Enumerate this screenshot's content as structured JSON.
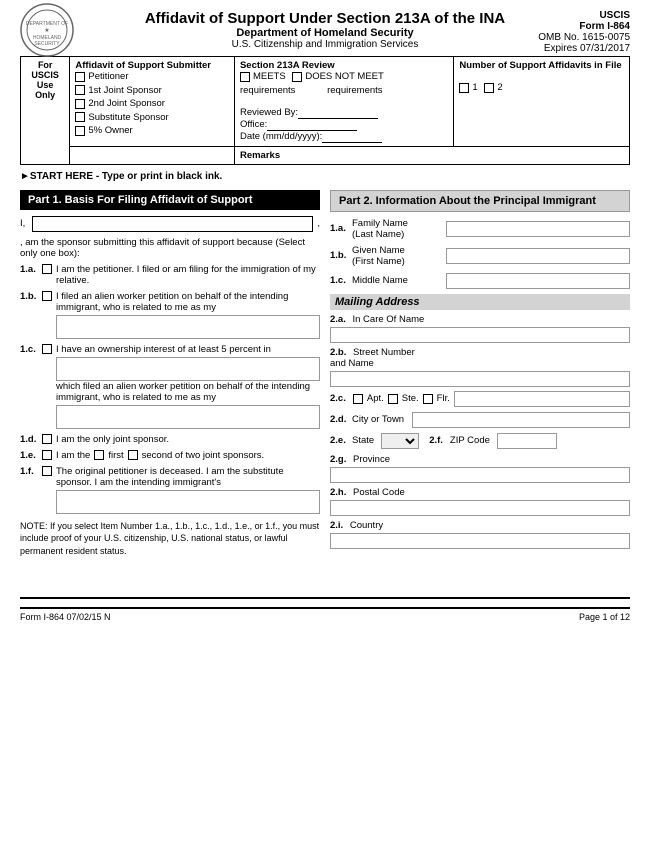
{
  "header": {
    "title": "Affidavit of Support Under Section 213A of the INA",
    "dept": "Department of Homeland Security",
    "agency": "U.S. Citizenship and Immigration Services",
    "uscis": "USCIS",
    "form": "Form I-864",
    "omb": "OMB No. 1615-0075",
    "expires": "Expires 07/31/2017"
  },
  "top_table": {
    "for_label": "For",
    "uscis_label": "USCIS",
    "use_label": "Use",
    "only_label": "Only",
    "affidavit_header": "Affidavit of Support Submitter",
    "options": [
      "Petitioner",
      "1st Joint Sponsor",
      "2nd Joint Sponsor",
      "Substitute Sponsor",
      "5% Owner"
    ],
    "section_header": "Section 213A Review",
    "meets": "MEETS",
    "does_not_meet": "DOES NOT MEET",
    "requirements": "requirements",
    "reviewed_by": "Reviewed By:",
    "office": "Office:",
    "date": "Date (mm/dd/yyyy):",
    "number_header": "Number of Support Affidavits in File",
    "num1": "1",
    "num2": "2",
    "remarks": "Remarks"
  },
  "start_here": "►START HERE - Type or print in black ink.",
  "part1": {
    "header": "Part 1.  Basis For Filing Affidavit of Support",
    "intro": "I,",
    "intro2": ", am the sponsor submitting this affidavit of support because (Select only one box):",
    "item1a_num": "1.a.",
    "item1a": "I am the petitioner.  I filed or am filing for the immigration of my relative.",
    "item1b_num": "1.b.",
    "item1b": "I filed an alien worker petition on behalf of the intending immigrant, who is related to me as my",
    "item1c_num": "1.c.",
    "item1c": "I have an ownership interest of at least 5 percent in",
    "item1c2": "which filed an alien worker petition on behalf of the intending immigrant, who is related to me as my",
    "item1d_num": "1.d.",
    "item1d": "I am the only joint sponsor.",
    "item1e_num": "1.e.",
    "item1e_pre": "I am the",
    "item1e_first": "first",
    "item1e_second": "second of two joint sponsors.",
    "item1f_num": "1.f.",
    "item1f": "The original petitioner is deceased.  I am the substitute sponsor.  I am the intending immigrant's",
    "note": "NOTE:  If you select Item Number 1.a., 1.b., 1.c., 1.d., 1.e., or 1.f., you must include proof of your U.S. citizenship, U.S. national status, or lawful permanent resident status."
  },
  "part2": {
    "header": "Part 2.  Information About the Principal Immigrant",
    "1a_label": "1.a.",
    "1a_sublabel": "Family Name\n(Last Name)",
    "1b_label": "1.b.",
    "1b_sublabel": "Given Name\n(First Name)",
    "1c_label": "1.c.",
    "1c_sublabel": "Middle Name",
    "mailing_header": "Mailing Address",
    "2a_label": "2.a.",
    "2a_sublabel": "In Care Of Name",
    "2b_label": "2.b.",
    "2b_sublabel": "Street Number\nand Name",
    "2c_label": "2.c.",
    "2c_apt": "Apt.",
    "2c_ste": "Ste.",
    "2c_flr": "Flr.",
    "2d_label": "2.d.",
    "2d_sublabel": "City or Town",
    "2e_label": "2.e.",
    "2e_sublabel": "State",
    "2f_label": "2.f.",
    "2f_sublabel": "ZIP Code",
    "2g_label": "2.g.",
    "2g_sublabel": "Province",
    "2h_label": "2.h.",
    "2h_sublabel": "Postal Code",
    "2i_label": "2.i.",
    "2i_sublabel": "Country"
  },
  "footer": {
    "left": "Form I-864  07/02/15  N",
    "right": "Page 1 of 12"
  }
}
